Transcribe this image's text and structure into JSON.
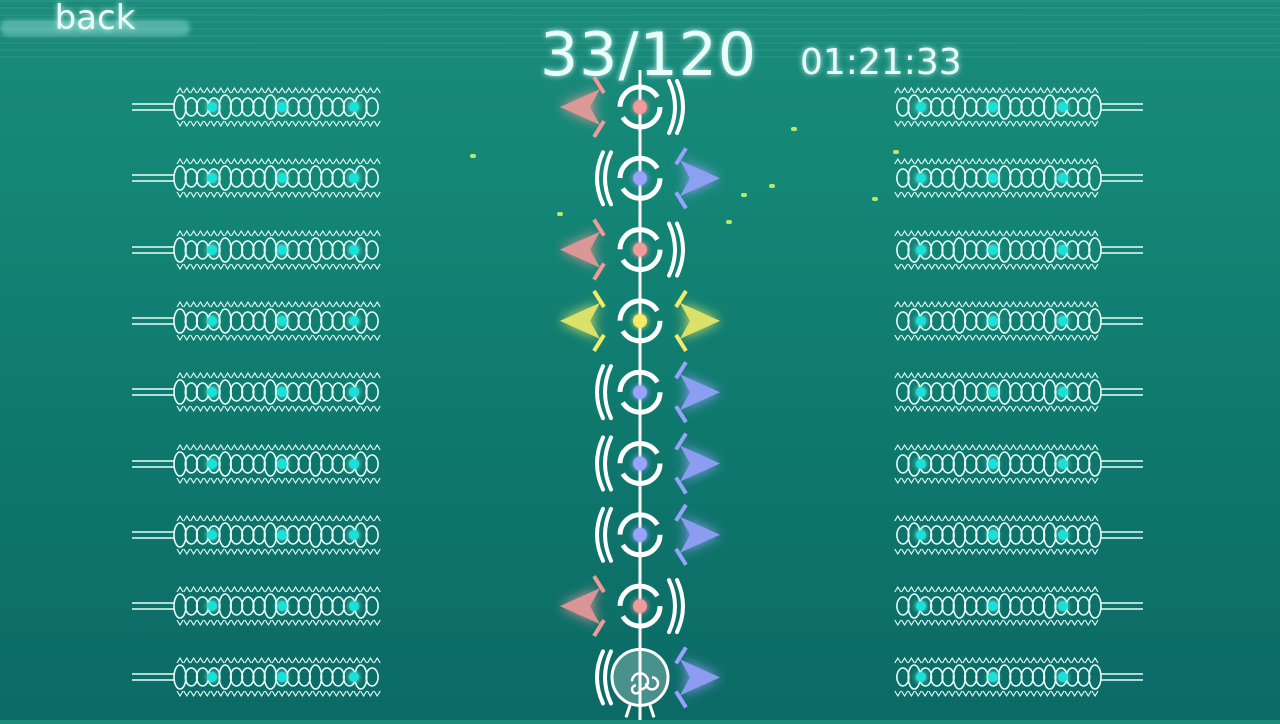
{
  "hud": {
    "back_label": "back",
    "progress": "33/120",
    "timer": "01:21:33"
  },
  "board": {
    "rows": 9,
    "lane_rows": [
      {
        "left": "red",
        "right": "none",
        "center": "red"
      },
      {
        "left": "none",
        "right": "blue",
        "center": "blue"
      },
      {
        "left": "red",
        "right": "none",
        "center": "red"
      },
      {
        "left": "yellow",
        "right": "yellow",
        "center": "yellow"
      },
      {
        "left": "none",
        "right": "blue",
        "center": "blue"
      },
      {
        "left": "none",
        "right": "blue",
        "center": "blue"
      },
      {
        "left": "none",
        "right": "blue",
        "center": "blue"
      },
      {
        "left": "red",
        "right": "none",
        "center": "red"
      },
      {
        "left": "none",
        "right": "blue",
        "center": "player"
      }
    ]
  },
  "colors": {
    "background": "#14806f",
    "glow": "#e9fffb",
    "chain_node": "#19e0d8",
    "red": "#f09a9a",
    "blue": "#9aa2ff",
    "yellow": "#f3ec6a"
  }
}
